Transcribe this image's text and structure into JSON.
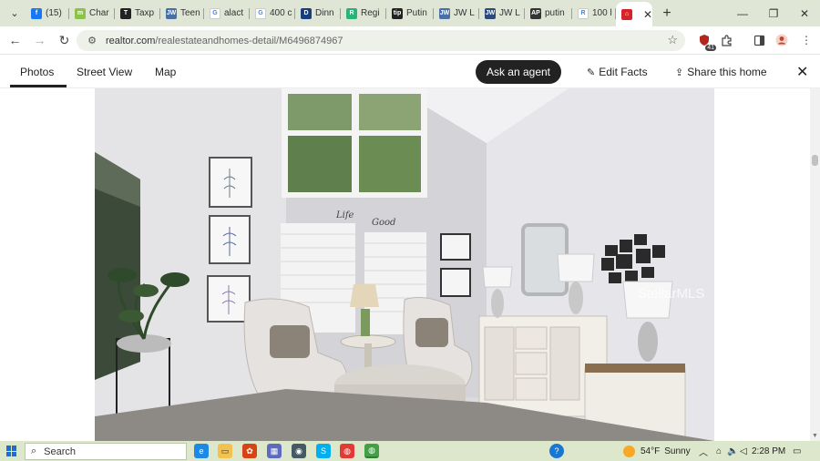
{
  "browser": {
    "tabs": [
      {
        "label": "(15)",
        "fav_color": "#1877f2",
        "fav_glyph": "f",
        "icon": "facebook-icon"
      },
      {
        "label": "Char",
        "fav_color": "#8bc34a",
        "fav_glyph": "m",
        "icon": "chart-site-icon"
      },
      {
        "label": "Taxp",
        "fav_color": "#222222",
        "fav_glyph": "T",
        "icon": "tax-site-icon"
      },
      {
        "label": "Teen",
        "fav_color": "#4a6fa5",
        "fav_glyph": "JW",
        "icon": "jw-icon"
      },
      {
        "label": "alact",
        "fav_color": "#ffffff",
        "fav_glyph": "G",
        "icon": "google-icon"
      },
      {
        "label": "400 c",
        "fav_color": "#ffffff",
        "fav_glyph": "G",
        "icon": "google-icon"
      },
      {
        "label": "Dinn",
        "fav_color": "#1a3d7c",
        "fav_glyph": "D",
        "icon": "dinner-site-icon"
      },
      {
        "label": "Regi",
        "fav_color": "#2ab27b",
        "fav_glyph": "R",
        "icon": "register-site-icon"
      },
      {
        "label": "Putin",
        "fav_color": "#222222",
        "fav_glyph": "tip",
        "icon": "tip-site-icon"
      },
      {
        "label": "JW L",
        "fav_color": "#4a6fa5",
        "fav_glyph": "JW",
        "icon": "jw-icon"
      },
      {
        "label": "JW L",
        "fav_color": "#2d4a7a",
        "fav_glyph": "JW",
        "icon": "jw-library-icon"
      },
      {
        "label": "putin",
        "fav_color": "#333333",
        "fav_glyph": "AP",
        "icon": "ap-news-icon"
      },
      {
        "label": "100 l",
        "fav_color": "#ffffff",
        "fav_glyph": "R",
        "icon": "realtor-r-icon"
      },
      {
        "label": "",
        "fav_color": "#d92228",
        "fav_glyph": "⌂",
        "icon": "realtor-home-icon",
        "active": true
      }
    ],
    "url_host": "realtor.com",
    "url_path": "/realestateandhomes-detail/M6496874967",
    "ext_badge": "41"
  },
  "viewer": {
    "tabs": [
      "Photos",
      "Street View",
      "Map"
    ],
    "ask_agent": "Ask an agent",
    "edit_facts": "Edit Facts",
    "share": "Share this home",
    "watermark": "StellarMLS",
    "wall_decal_1": "Life",
    "wall_decal_2": "Good"
  },
  "taskbar": {
    "search_label": "Search",
    "weather_temp": "54°F",
    "weather_text": "Sunny",
    "time": "2:28 PM"
  }
}
